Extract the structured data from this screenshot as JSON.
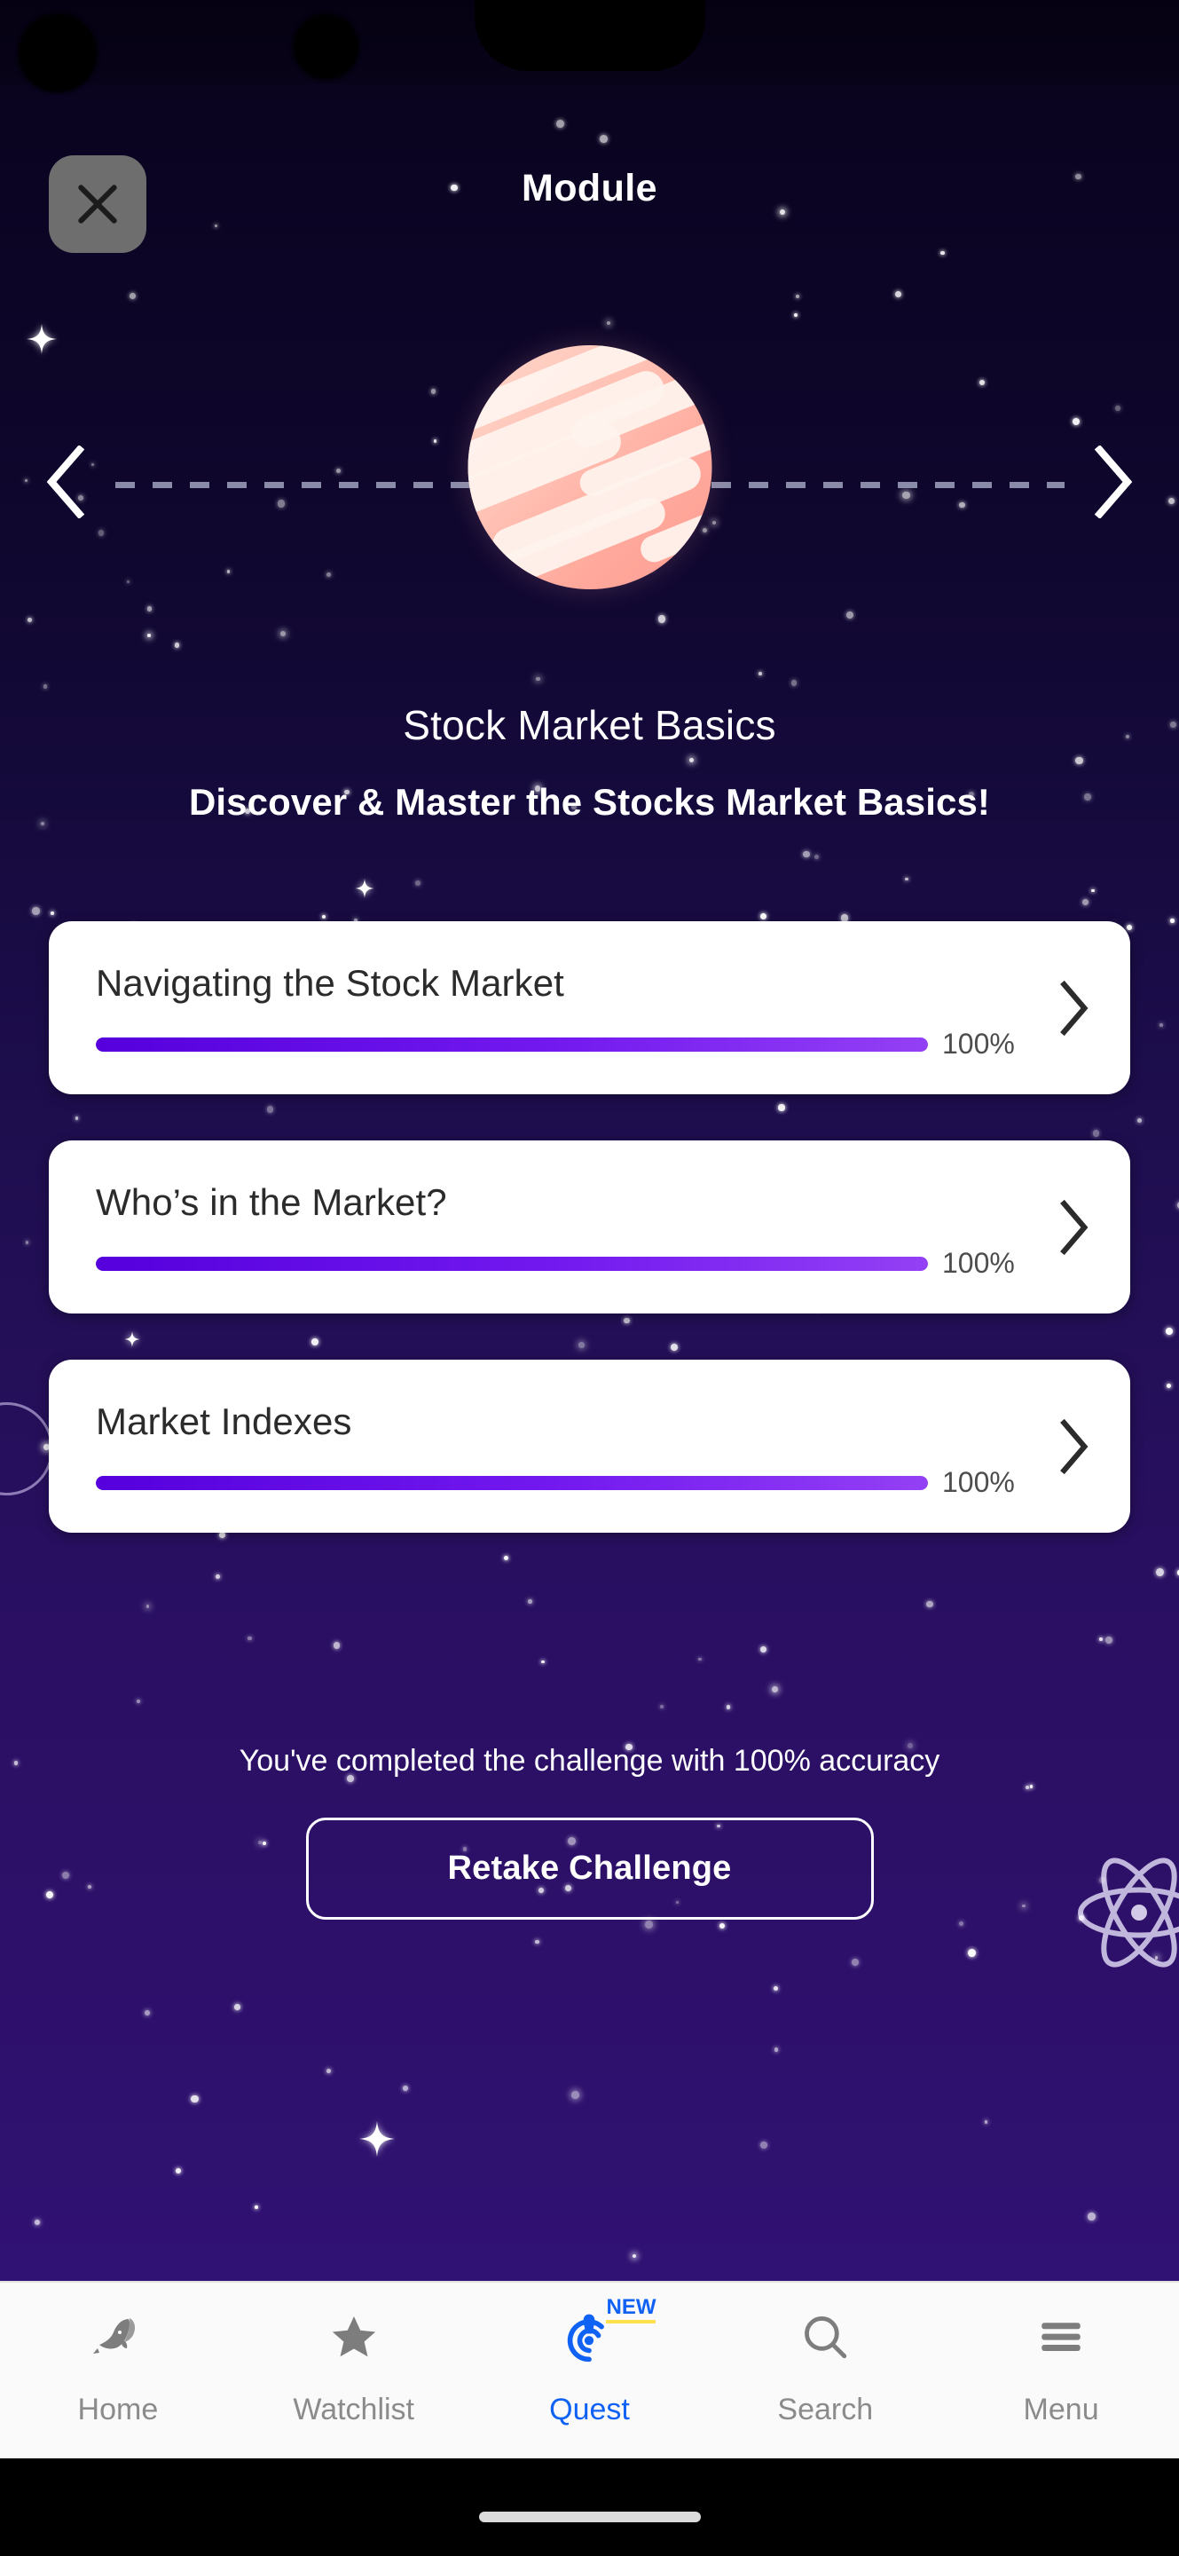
{
  "header": {
    "title": "Module",
    "close_icon": "close-icon",
    "close_label": "Close"
  },
  "carousel": {
    "prev_icon": "chevron-left-icon",
    "next_icon": "chevron-right-icon",
    "planet_icon": "planet-icon",
    "planet_color": "#ffb1a2"
  },
  "module": {
    "title": "Stock Market Basics",
    "subtitle": "Discover & Master the Stocks Market Basics!"
  },
  "lessons": [
    {
      "title": "Navigating the Stock Market",
      "progress_label": "100%",
      "progress_value": 100,
      "chevron_icon": "chevron-right-icon"
    },
    {
      "title": "Who’s in the Market?",
      "progress_label": "100%",
      "progress_value": 100,
      "chevron_icon": "chevron-right-icon"
    },
    {
      "title": "Market Indexes",
      "progress_label": "100%",
      "progress_value": 100,
      "chevron_icon": "chevron-right-icon"
    }
  ],
  "challenge": {
    "status_text": "You've completed the challenge with 100% accuracy",
    "retake_label": "Retake Challenge"
  },
  "tabbar": {
    "active_color": "#1062f5",
    "inactive_color": "#8b8b8b",
    "badge_underline_color": "#ffe14d",
    "items": [
      {
        "label": "Home",
        "icon": "whale-icon",
        "active": false
      },
      {
        "label": "Watchlist",
        "icon": "star-icon",
        "active": false
      },
      {
        "label": "Quest",
        "icon": "quest-target-icon",
        "active": true,
        "badge": "NEW"
      },
      {
        "label": "Search",
        "icon": "search-icon",
        "active": false
      },
      {
        "label": "Menu",
        "icon": "hamburger-menu-icon",
        "active": false
      }
    ]
  },
  "colors": {
    "progress_start": "#5500dd",
    "progress_end": "#9340f5",
    "card_background": "#ffffff",
    "background_top": "#070218",
    "background_bottom": "#31127a"
  }
}
